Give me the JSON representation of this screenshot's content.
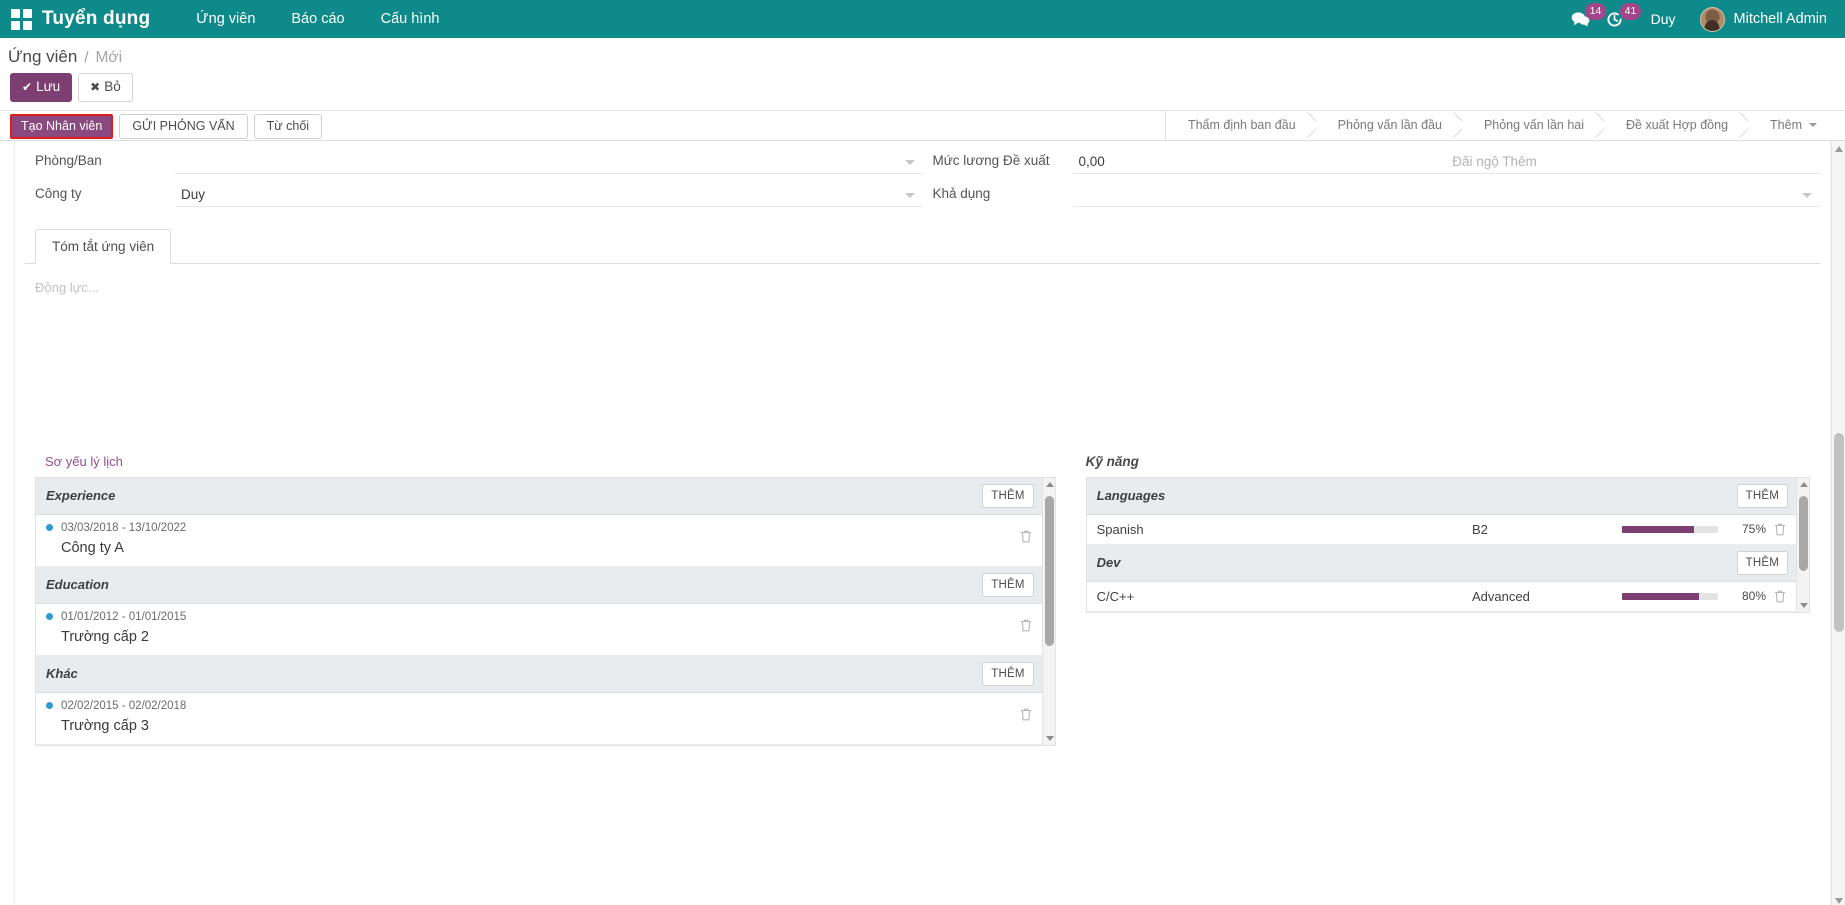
{
  "navbar": {
    "apps_icon": "apps-grid-icon",
    "brand": "Tuyển dụng",
    "menu": [
      {
        "label": "Ứng viên"
      },
      {
        "label": "Báo cáo"
      },
      {
        "label": "Cấu hình"
      }
    ],
    "messages": {
      "icon": "chat-icon",
      "count": "14"
    },
    "activities": {
      "icon": "clock-icon",
      "count": "41"
    },
    "user_alias": "Duy",
    "user_name": "Mitchell Admin",
    "accent_color": "#0f8a8a",
    "badge_color": "#a24689"
  },
  "breadcrumb": {
    "root": "Ứng viên",
    "separator": "/",
    "current": "Mới"
  },
  "record_controls": {
    "save_label": "Lưu",
    "save_icon": "check-icon",
    "discard_label": "Bỏ",
    "discard_icon": "times-icon",
    "primary_color": "#7d3f72"
  },
  "action_bar": {
    "buttons": [
      {
        "label": "Tạo Nhân viên",
        "style": "primary-highlighted"
      },
      {
        "label": "GỬI PHỎNG VẤN",
        "style": "default"
      },
      {
        "label": "Từ chối",
        "style": "default"
      }
    ],
    "highlight_color": "#e01b1b",
    "stages": [
      {
        "label": "Thẩm định ban đầu"
      },
      {
        "label": "Phỏng vấn lần đầu"
      },
      {
        "label": "Phỏng vấn lần hai"
      },
      {
        "label": "Đề xuất Hợp đồng"
      },
      {
        "label": "Thêm",
        "has_caret": true
      }
    ]
  },
  "form": {
    "left_fields": [
      {
        "label": "Phòng/Ban",
        "value": "",
        "widget": "dropdown"
      },
      {
        "label": "Công ty",
        "value": "Duy",
        "widget": "dropdown"
      }
    ],
    "right_fields": [
      {
        "label": "Mức lương Đề xuất",
        "value": "0,00",
        "extra_placeholder": "Đãi ngộ Thêm",
        "widget": "split"
      },
      {
        "label": "Khả dụng",
        "value": "",
        "widget": "dropdown"
      }
    ]
  },
  "notebook": {
    "tabs": [
      {
        "label": "Tóm tắt ứng viên",
        "active": true
      }
    ],
    "motivation_placeholder": "Động lực..."
  },
  "resume": {
    "title": "Sơ yếu lý lịch",
    "groups": [
      {
        "name": "Experience",
        "add_label": "THÊM",
        "entries": [
          {
            "dates": "03/03/2018 - 13/10/2022",
            "title": "Công ty A",
            "delete_icon": "trash-icon"
          }
        ]
      },
      {
        "name": "Education",
        "add_label": "THÊM",
        "entries": [
          {
            "dates": "01/01/2012 - 01/01/2015",
            "title": "Trường cấp 2",
            "delete_icon": "trash-icon"
          }
        ]
      },
      {
        "name": "Khác",
        "add_label": "THÊM",
        "entries": [
          {
            "dates": "02/02/2015 - 02/02/2018",
            "title": "Trường cấp 3",
            "delete_icon": "trash-icon"
          }
        ]
      }
    ]
  },
  "skills": {
    "title": "Kỹ năng",
    "progress_color": "#7d3f72",
    "groups": [
      {
        "name": "Languages",
        "add_label": "THÊM",
        "rows": [
          {
            "skill": "Spanish",
            "level": "B2",
            "percent": 75,
            "percent_label": "75%",
            "delete_icon": "trash-icon"
          }
        ]
      },
      {
        "name": "Dev",
        "add_label": "THÊM",
        "rows": [
          {
            "skill": "C/C++",
            "level": "Advanced",
            "percent": 80,
            "percent_label": "80%",
            "delete_icon": "trash-icon"
          }
        ]
      }
    ]
  }
}
